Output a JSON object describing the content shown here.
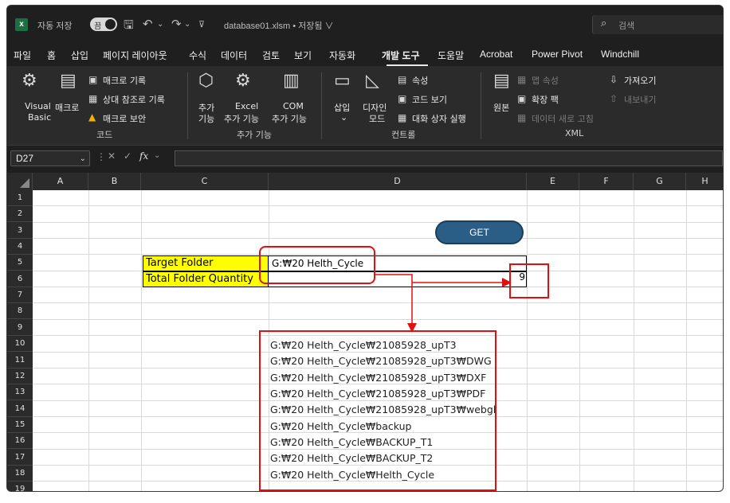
{
  "titlebar": {
    "autosave_label": "자동 저장",
    "toggle_state": "끔",
    "filename": "database01.xlsm • 저장됨 ∨",
    "search_placeholder": "검색"
  },
  "menu": [
    "파일",
    "홈",
    "삽입",
    "페이지 레이아웃",
    "수식",
    "데이터",
    "검토",
    "보기",
    "자동화",
    "개발 도구",
    "도움말",
    "Acrobat",
    "Power Pivot",
    "Windchill"
  ],
  "ribbon": {
    "code": {
      "visual_basic": "Visual\nBasic",
      "visual_basic_1": "Visual",
      "visual_basic_2": "Basic",
      "macro": "매크로",
      "record_macro": "매크로 기록",
      "relative_ref": "상대 참조로 기록",
      "macro_security": "매크로 보안",
      "group": "코드"
    },
    "addins": {
      "addins_1": "추가",
      "addins_2": "기능",
      "excel_addins_1": "Excel",
      "excel_addins_2": "추가 기능",
      "com_addins_1": "COM",
      "com_addins_2": "추가 기능",
      "group": "추가 기능"
    },
    "controls": {
      "insert": "삽입",
      "design_1": "디자인",
      "design_2": "모드",
      "properties": "속성",
      "view_code": "코드 보기",
      "run_dialog": "대화 상자 실행",
      "group": "컨트롤"
    },
    "xml": {
      "source": "원본",
      "map_properties": "맵 속성",
      "expansion_packs": "확장 팩",
      "refresh_data": "데이터 새로 고침",
      "import": "가져오기",
      "export": "내보내기",
      "group": "XML"
    }
  },
  "formula_bar": {
    "name_box": "D27",
    "fx": "fx",
    "content": ""
  },
  "columns": [
    "A",
    "B",
    "C",
    "D",
    "E",
    "F",
    "G",
    "H"
  ],
  "rows": [
    "1",
    "2",
    "3",
    "4",
    "5",
    "6",
    "7",
    "8",
    "9",
    "10",
    "11",
    "12",
    "13",
    "14",
    "15",
    "16",
    "17",
    "18",
    "19"
  ],
  "sheet": {
    "get_button": "GET",
    "target_folder_label": "Target Folder",
    "target_folder_value": "G:₩20 Helth_Cycle",
    "total_qty_label": "Total Folder Quantity",
    "total_qty_value": "9",
    "folders": [
      "G:₩20 Helth_Cycle₩21085928_upT3",
      "G:₩20 Helth_Cycle₩21085928_upT3₩DWG",
      "G:₩20 Helth_Cycle₩21085928_upT3₩DXF",
      "G:₩20 Helth_Cycle₩21085928_upT3₩PDF",
      "G:₩20 Helth_Cycle₩21085928_upT3₩webgl",
      "G:₩20 Helth_Cycle₩backup",
      "G:₩20 Helth_Cycle₩BACKUP_T1",
      "G:₩20 Helth_Cycle₩BACKUP_T2",
      "G:₩20 Helth_Cycle₩Helth_Cycle"
    ]
  },
  "colors": {
    "accent_red": "#e01010",
    "label_yellow": "#ffff00",
    "button_blue": "#2b5e86"
  }
}
